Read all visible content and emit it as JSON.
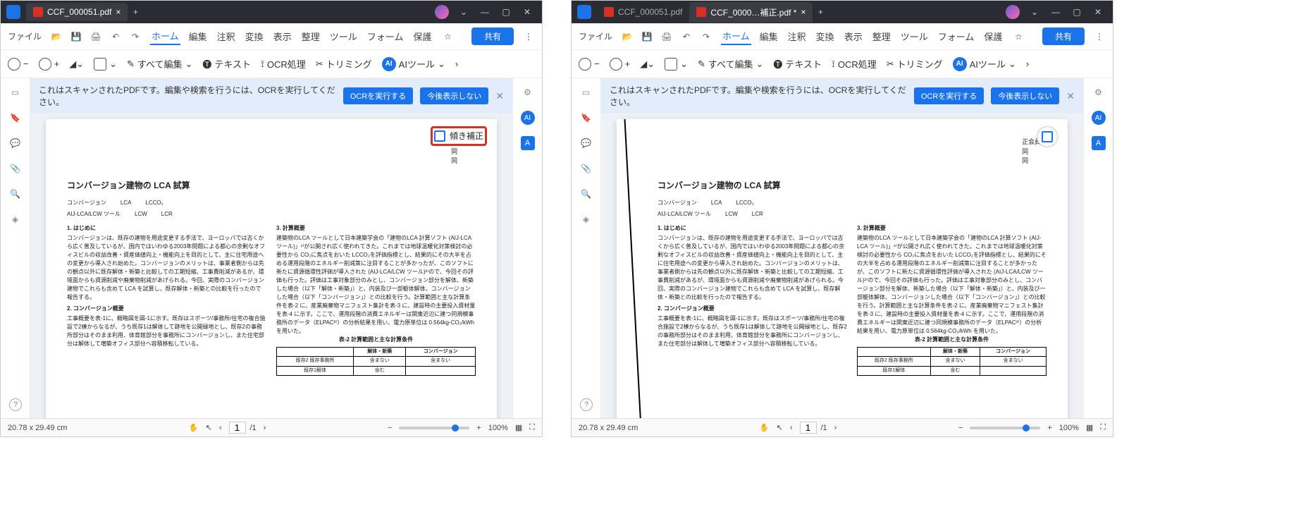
{
  "left": {
    "tab_title": "CCF_000051.pdf",
    "file_menu": "ファイル",
    "menu": {
      "home": "ホーム",
      "edit": "編集",
      "comment": "注釈",
      "convert": "変換",
      "view": "表示",
      "organize": "整理",
      "tools": "ツール",
      "form": "フォーム",
      "protect": "保護"
    },
    "share": "共有",
    "toolbar": {
      "edit_all": "すべて編集",
      "text": "テキスト",
      "ocr": "OCR処理",
      "trim": "トリミング",
      "ai": "AIツール"
    },
    "banner": {
      "msg": "これはスキャンされたPDFです。編集や検索を行うには、OCRを実行してください。",
      "btn1": "OCRを実行する",
      "btn2": "今後表示しない"
    },
    "deskew_label": "傾き補正",
    "doc": {
      "title": "コンバージョン建物の LCA 試算",
      "member": "正会員 ○",
      "same": "同",
      "kw1": "コンバージョン",
      "kw2": "LCA",
      "kw3": "LCCO₂",
      "kw4": "AIJ-LCA/LCW ツール",
      "kw5": "LCW",
      "kw6": "LCR",
      "s1": "1. はじめに",
      "s2": "2. コンバージョン概要",
      "s3": "3. 計算概要",
      "p1": "コンバージョンは、既存の建物を用途変更する手法で、ヨーロッパでは古くから広く普及しているが、国内ではいわゆる2003年問題による都心の余剰なオフィスビルの収益改善・資産価値向上・機能向上を目的として、主に住宅用途への変更から導入され始めた。コンバージョンのメリットは、事業者側からは先の観点以外に既存解体・新築と比較しての工期短縮、工事費削減があるが、環境面からも資源削減や廃棄物削減があげられる。今回、実際のコンバージョン建物でこれらも含めて LCA を試算し、既存解体・新築との比較を行ったので報告する。",
      "p2": "工事概要を表-1に、概略図を図-1に示す。既存はスポーツ/事務所/住宅の複合施設で2棟からなるが、うち既存1は解体して跡地を公開緑地とし、既存2の事務所部分はそのまま利用、体育館部分を事務所にコンバージョンし、また住宅部分は解体して増築オフィス部分へ容積移転している。",
      "p3": "建築物のLCA ツールとして日本建築学会の「建物のLCA 計算ソフト (AIJ-LCA ツール)」¹⁾が公開され広く使われてきた。これまでは地球温暖化対策検討の必要性から CO₂に焦点をおいた LCCO₂を評価指標とし、結果的にその大半を占める運用段階のエネルギー削減策に注目することが多かったが、このソフトに新たに資源循環性評価が導入された (AIJ-LCA/LCW ツール)²⁾ので、今回その評価も行った。評価は工事対象部分のみとし、コンバージョン部分を解体、新築した場合（以下「解体・新築」）と、内装及び一部躯体解体、コンバージョンした場合（以下「コンバージョン」）との比較を行う。計算範囲と主な計算条件を表-2 に、産業廃棄物マニフェスト集計を表-3 に、建設時の主要投入資材量を表-4 に示す。ここで、運用段階の消費エネルギーは関東近辺に建つ同規模事務所のデータ（ELPAC³⁾）の分析結果を用い、電力原単位は 0.564kg-CO₂/kWh を用いた。",
      "tcap": "表-2 計算範囲と主な計算条件",
      "th1": "解体・新築",
      "th2": "コンバージョン",
      "tr1": "既存2 既存事務所",
      "tr2": "既存1解体",
      "td1": "含まない",
      "td2": "含む"
    },
    "status": {
      "dim": "20.78 x 29.49 cm",
      "page": "1",
      "total": "/1",
      "zoom": "100%"
    }
  },
  "right": {
    "tab0": "CCF_000051.pdf",
    "tab1": "CCF_0000…補正.pdf *",
    "status": {
      "dim": "20.78 x 29.49 cm",
      "page": "1",
      "total": "/1",
      "zoom": "100%"
    }
  }
}
